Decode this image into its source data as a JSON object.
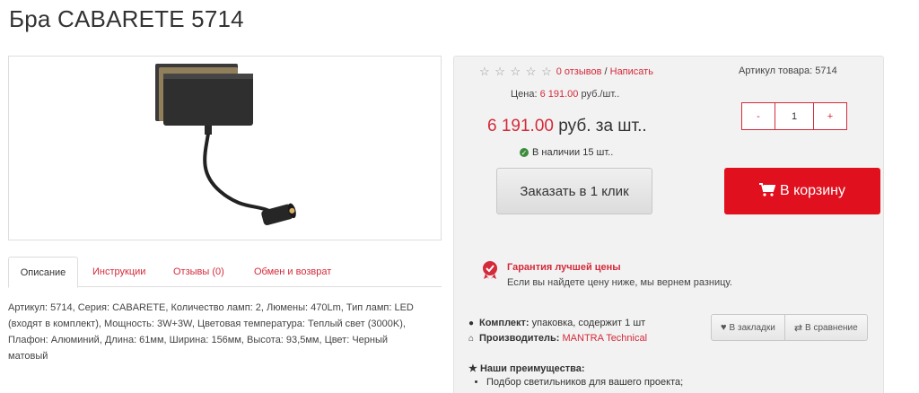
{
  "product": {
    "title": "Бра CABARETE 5714",
    "sku_label": "Артикул товара:",
    "sku_value": "5714"
  },
  "tabs": [
    {
      "label": "Описание"
    },
    {
      "label": "Инструкции"
    },
    {
      "label": "Отзывы (0)"
    },
    {
      "label": "Обмен и возврат"
    }
  ],
  "description": "Артикул: 5714, Серия: CABARETE, Количество ламп: 2, Люмены: 470Lm, Тип ламп: LED (входят в комплект), Мощность: 3W+3W, Цветовая температура: Теплый свет (3000K), Плафон: Алюминий, Длина: 61мм, Ширина: 156мм, Высота: 93,5мм, Цвет: Черный матовый",
  "rating": {
    "stars": "☆ ☆ ☆ ☆ ☆",
    "reviews_link": "0 отзывов",
    "separator": " / ",
    "write_link": "Написать"
  },
  "price": {
    "small_label": "Цена:",
    "small_value": "6 191.00",
    "small_unit": " руб./шт..",
    "big_value": "6 191.00",
    "big_unit": " руб. за шт..",
    "stock": "В наличии 15 шт.."
  },
  "quantity": {
    "minus": "-",
    "value": "1",
    "plus": "+"
  },
  "buttons": {
    "one_click": "Заказать в 1 клик",
    "cart": "В корзину",
    "bookmarks": "В закладки",
    "compare": "В сравнение"
  },
  "guarantee": {
    "title": "Гарантия лучшей цены",
    "text": "Если вы найдете цену ниже, мы вернем разницу."
  },
  "meta": {
    "kit_label": "Комплект:",
    "kit_value": " упаковка, содержит 1 шт",
    "maker_label": "Производитель:",
    "maker_value": "MANTRA Technical"
  },
  "advantages": {
    "title": "Наши преимущества:",
    "items": [
      "Подбор светильников для вашего проекта;"
    ]
  },
  "colors": {
    "accent": "#d42a3a",
    "cart_button": "#e0101f",
    "stock_ok": "#3c8c3c"
  }
}
